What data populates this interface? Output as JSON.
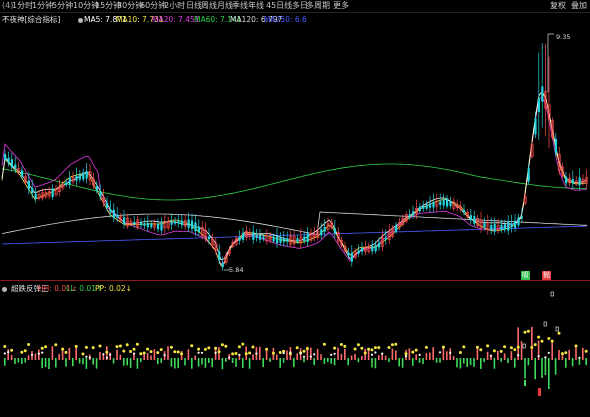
{
  "toolbar": {
    "items": [
      "(4)",
      "1分时",
      "1分钟",
      "5分钟",
      "10分钟",
      "15分钟",
      "30分钟",
      "60分钟",
      "2小时",
      "日线",
      "周线",
      "月线",
      "季线",
      "年线",
      "45日线",
      "多日",
      "多周期",
      "更多"
    ],
    "right": [
      "复权",
      "叠加"
    ]
  },
  "main_legend": {
    "title": "不夜神[综合指标]",
    "items": [
      {
        "label": "MA5: 7.871",
        "color": "#ffffff"
      },
      {
        "label": "MA10: 7.731",
        "color": "#f5e642"
      },
      {
        "label": "MA20: 7.451",
        "color": "#e23ce8"
      },
      {
        "label": "MA60: 7.141",
        "color": "#2fd04a"
      },
      {
        "label": "MA120: 6.797",
        "color": "#d8d8d8"
      },
      {
        "label": "MA250: 6.6",
        "color": "#4b5cff"
      }
    ]
  },
  "sub_legend": {
    "title": "超跌反弹王",
    "items": [
      {
        "label": "HH: 0.01↓",
        "color": "#f54b4b"
      },
      {
        "label": "LL: 0.01↑",
        "color": "#2fd04a"
      },
      {
        "label": "PP: 0.02↓",
        "color": "#f5e642"
      }
    ]
  },
  "annotations": {
    "high_price": "9.35",
    "low_price": "5.84"
  },
  "signals": {
    "buy": "吸",
    "sell": "抛",
    "sell_color": "#e23c3c",
    "buy_color": "#2fbf4a"
  },
  "colors": {
    "up": "#ff4d4d",
    "down": "#25d5e0",
    "background": "#000000",
    "divider": "#8b1a1a"
  },
  "chart_data": {
    "type": "candlestick",
    "price_high": 9.35,
    "price_low": 5.84,
    "grid": false,
    "series": [
      {
        "name": "MA5",
        "color": "#ffffff"
      },
      {
        "name": "MA10",
        "color": "#f5e642"
      },
      {
        "name": "MA20",
        "color": "#e23ce8"
      },
      {
        "name": "MA60",
        "color": "#2fd04a"
      },
      {
        "name": "MA120",
        "color": "#d8d8d8"
      },
      {
        "name": "MA250",
        "color": "#4b5cff"
      }
    ]
  }
}
